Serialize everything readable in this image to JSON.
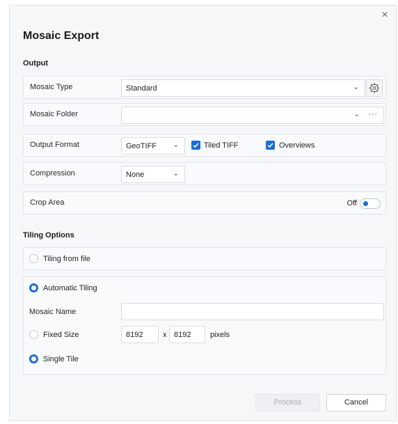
{
  "dialog": {
    "title": "Mosaic Export",
    "close_glyph": "×"
  },
  "output": {
    "heading": "Output",
    "mosaic_type": {
      "label": "Mosaic Type",
      "value": "Standard",
      "icon": "gear-icon"
    },
    "mosaic_folder": {
      "label": "Mosaic Folder",
      "value": "",
      "browse_glyph": "···"
    },
    "output_format": {
      "label": "Output Format",
      "value": "GeoTIFF",
      "tiled_tiff": {
        "label": "Tiled TIFF",
        "checked": true
      },
      "overviews": {
        "label": "Overviews",
        "checked": true
      }
    },
    "compression": {
      "label": "Compression",
      "value": "None"
    },
    "crop_area": {
      "label": "Crop Area",
      "state": "Off"
    }
  },
  "tiling": {
    "heading": "Tiling Options",
    "from_file": {
      "label": "Tiling from file",
      "selected": false
    },
    "automatic": {
      "label": "Automatic Tiling",
      "selected": true
    },
    "mosaic_name": {
      "label": "Mosaic Name",
      "value": ""
    },
    "fixed_size": {
      "label": "Fixed Size",
      "selected": false,
      "width": "8192",
      "sep": "x",
      "height": "8192",
      "unit": "pixels"
    },
    "single_tile": {
      "label": "Single Tile",
      "selected": true
    }
  },
  "buttons": {
    "process": "Process",
    "cancel": "Cancel"
  },
  "colors": {
    "accent": "#1c6fd1",
    "panel_bg": "#f9fafb",
    "dialog_bg": "#f6f7f9"
  }
}
